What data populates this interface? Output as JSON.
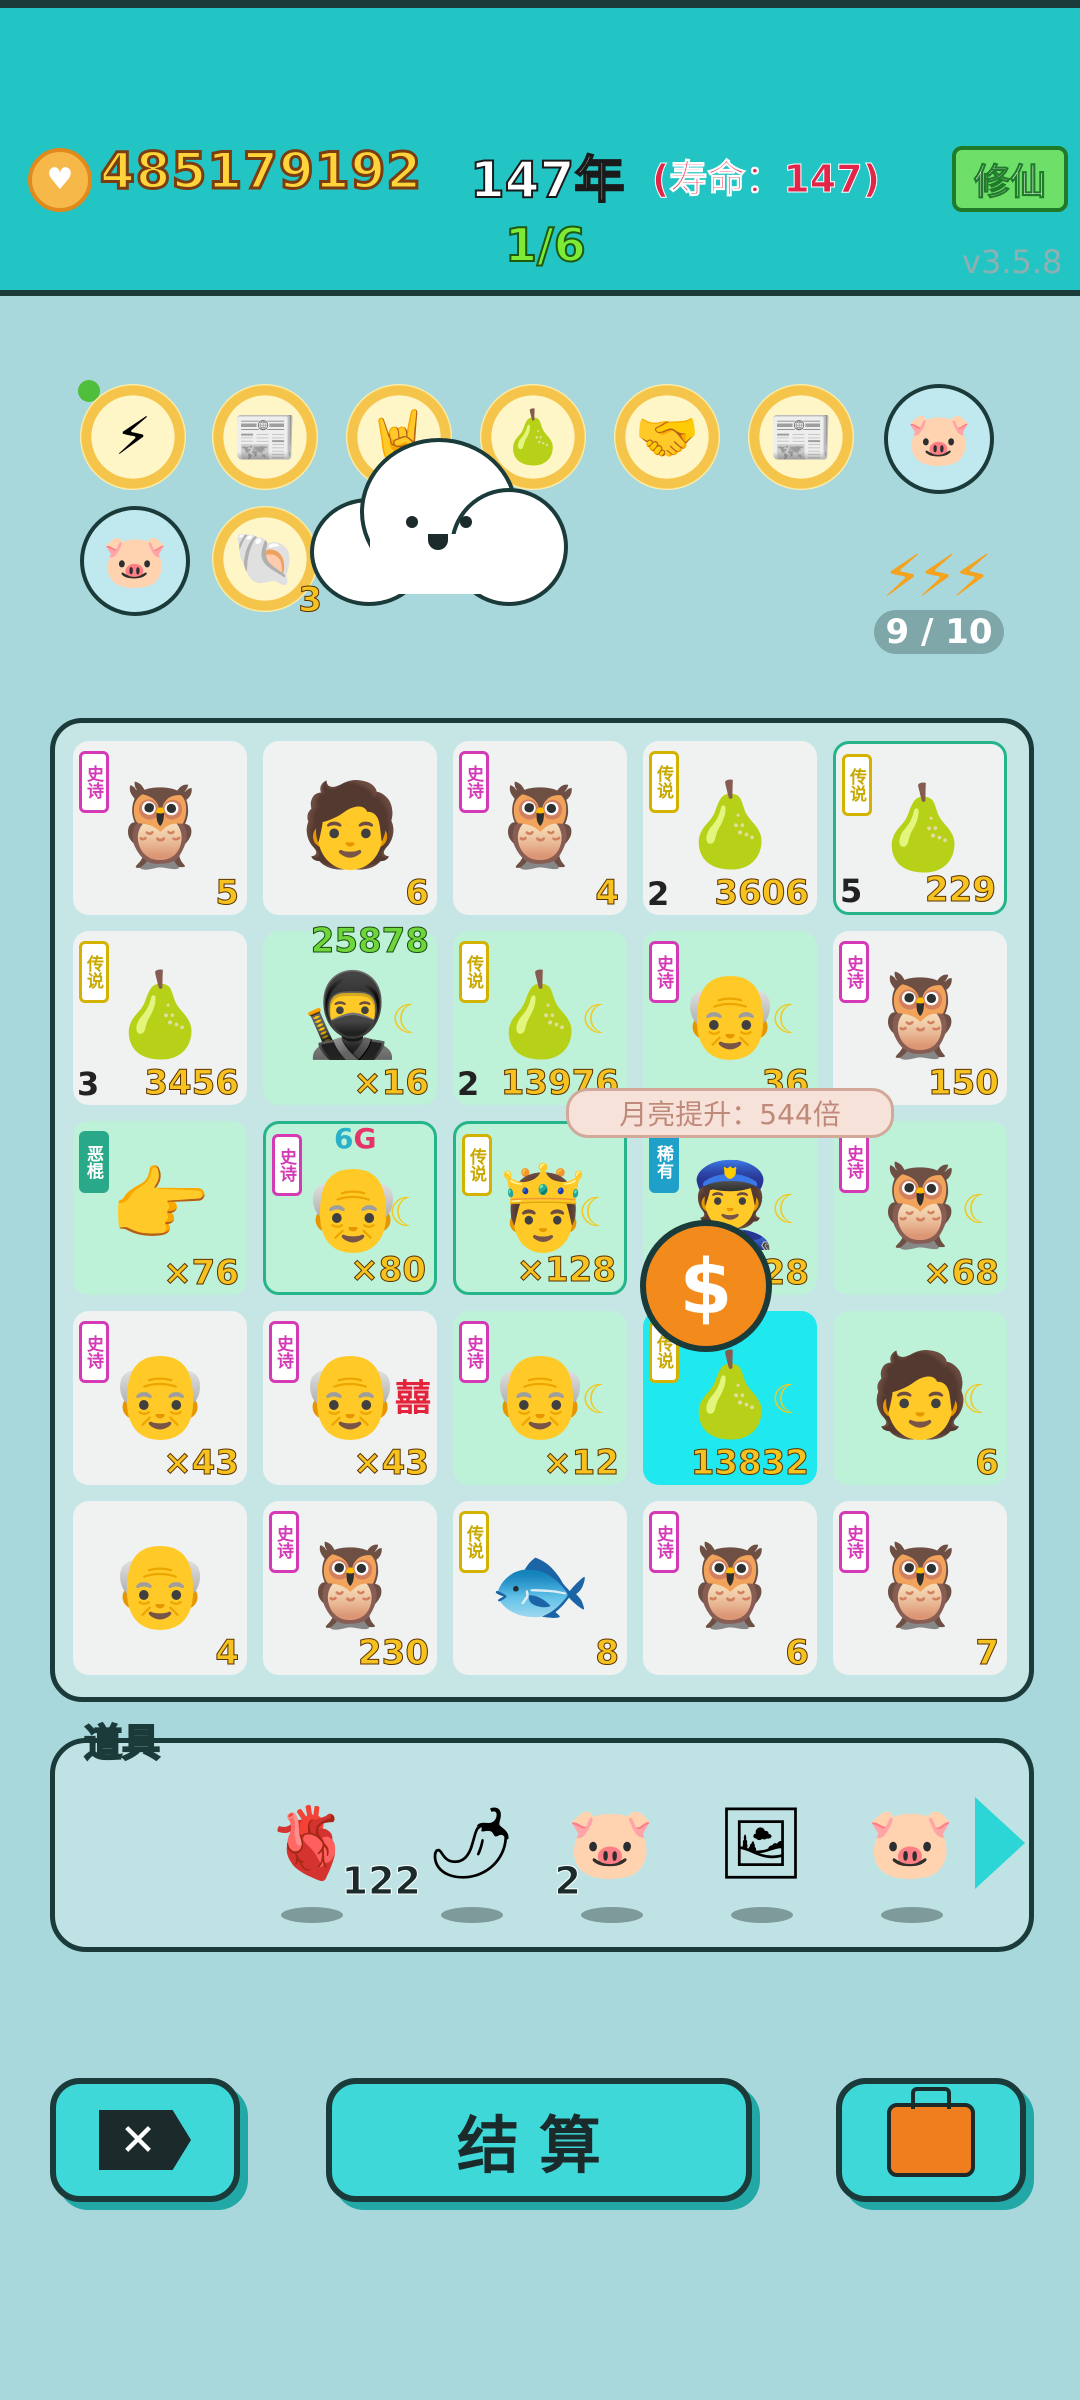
{
  "header": {
    "gold": "485179192",
    "year": "147年",
    "lifespan": "(寿命：147)",
    "progress": "1/6",
    "cultivate_label": "修仙",
    "version": "v3.5.8"
  },
  "badges": [
    {
      "icon": "lightning-icon",
      "glyph": "⚡"
    },
    {
      "icon": "time-magazine-icon",
      "glyph": "📰"
    },
    {
      "icon": "rock-hand-icon",
      "glyph": "🤘"
    },
    {
      "icon": "pear-grapefruit-icon",
      "glyph": "🍐"
    },
    {
      "icon": "handshake-icon",
      "glyph": "🤝"
    },
    {
      "icon": "time-magazine-icon",
      "glyph": "📰"
    },
    {
      "icon": "piggy-bank-icon",
      "glyph": "🐷"
    },
    {
      "icon": "piggy-bank-icon",
      "glyph": "🐷"
    },
    {
      "icon": "shell-icon",
      "glyph": "🐚",
      "count": "3"
    }
  ],
  "energy": {
    "count": "9 / 10",
    "icon": "lightning-icon"
  },
  "board": {
    "cells": [
      {
        "tag": "史诗",
        "tagType": "epic",
        "icon": "owl-grandpa-icon",
        "glyph": "🦉",
        "value": "5"
      },
      {
        "tag": "",
        "tagType": "",
        "icon": "man-face-icon",
        "glyph": "🧑",
        "value": "6"
      },
      {
        "tag": "史诗",
        "tagType": "epic",
        "icon": "owl-grandpa-icon",
        "glyph": "🦉",
        "value": "4"
      },
      {
        "tag": "传说",
        "tagType": "legend",
        "icon": "pear-icon",
        "glyph": "🍐",
        "level": "2",
        "value": "3606"
      },
      {
        "tag": "传说",
        "tagType": "legend",
        "icon": "pear-icon",
        "glyph": "🍐",
        "level": "5",
        "value": "229"
      },
      {
        "tag": "传说",
        "tagType": "legend",
        "icon": "pear-icon",
        "glyph": "🍐",
        "level": "3",
        "value": "3456"
      },
      {
        "tag": "",
        "tagType": "",
        "icon": "thief-face-icon",
        "glyph": "🥷",
        "top": "25878",
        "value": "×16"
      },
      {
        "tag": "传说",
        "tagType": "legend",
        "icon": "pear-icon",
        "glyph": "🍐",
        "level": "2",
        "value": "13976"
      },
      {
        "tag": "史诗",
        "tagType": "epic",
        "icon": "old-man-face-icon",
        "glyph": "👴",
        "value": "36"
      },
      {
        "tag": "史诗",
        "tagType": "epic",
        "icon": "owl-grandpa-icon",
        "glyph": "🦉",
        "value": "150"
      },
      {
        "tag": "恶棍",
        "tagType": "bad",
        "icon": "pointing-hand-icon",
        "glyph": "👉",
        "value": "×76"
      },
      {
        "tag": "史诗",
        "tagType": "epic",
        "icon": "old-man-face-icon",
        "glyph": "👴",
        "sixg_a": "6",
        "sixg_b": "G",
        "value": "×80"
      },
      {
        "tag": "传说",
        "tagType": "legend",
        "icon": "king-face-icon",
        "glyph": "🤴",
        "value": "×128"
      },
      {
        "tag": "稀有",
        "tagType": "rare",
        "icon": "police-face-icon",
        "glyph": "👮",
        "value": "28"
      },
      {
        "tag": "史诗",
        "tagType": "epic",
        "icon": "owl-grandpa-icon",
        "glyph": "🦉",
        "value": "×68"
      },
      {
        "tag": "史诗",
        "tagType": "epic",
        "icon": "old-man-face-icon",
        "glyph": "👴",
        "value": "×43"
      },
      {
        "tag": "史诗",
        "tagType": "epic",
        "icon": "old-man-face-icon",
        "glyph": "👴",
        "fu": "囍",
        "value": "×43"
      },
      {
        "tag": "史诗",
        "tagType": "epic",
        "icon": "old-man-face-icon",
        "glyph": "👴",
        "value": "×12"
      },
      {
        "tag": "传说",
        "tagType": "legend",
        "icon": "pear-icon",
        "glyph": "🍐",
        "value": "13832"
      },
      {
        "tag": "",
        "tagType": "",
        "icon": "man-face-icon",
        "glyph": "🧑",
        "value": "6"
      },
      {
        "tag": "",
        "tagType": "",
        "icon": "grandpa-face-icon",
        "glyph": "👴",
        "value": "4"
      },
      {
        "tag": "史诗",
        "tagType": "epic",
        "icon": "owl-grandpa-icon",
        "glyph": "🦉",
        "value": "230"
      },
      {
        "tag": "传说",
        "tagType": "legend",
        "icon": "koi-fish-icon",
        "glyph": "🐟",
        "value": "8"
      },
      {
        "tag": "史诗",
        "tagType": "epic",
        "icon": "owl-grandpa-icon",
        "glyph": "🦉",
        "value": "6"
      },
      {
        "tag": "史诗",
        "tagType": "epic",
        "icon": "owl-grandpa-icon",
        "glyph": "🦉",
        "value": "7"
      }
    ]
  },
  "tooltip": "月亮提升：544倍",
  "props": {
    "label": "道具",
    "items": [
      {
        "icon": "liver-icon",
        "glyph": "🫀",
        "count": "122"
      },
      {
        "icon": "chili-pepper-icon",
        "glyph": "🌶",
        "count": "2"
      },
      {
        "icon": "piggy-bank-icon",
        "glyph": "🐷",
        "count": ""
      },
      {
        "icon": "framed-picture-icon",
        "glyph": "🖼",
        "count": ""
      },
      {
        "icon": "piggy-bank-icon",
        "glyph": "🐷",
        "count": ""
      }
    ]
  },
  "actions": {
    "settle_label": "结算",
    "close_glyph": "✕"
  }
}
